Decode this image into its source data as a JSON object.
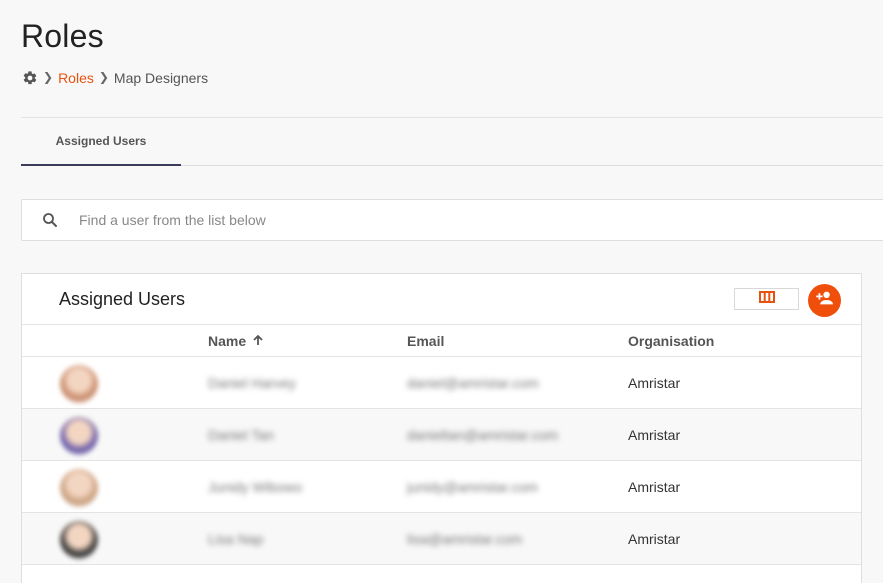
{
  "page": {
    "title": "Roles"
  },
  "breadcrumb": {
    "home_icon": "gear-icon",
    "items": [
      "Roles",
      "Map Designers"
    ]
  },
  "tabs": [
    {
      "label": "Assigned Users",
      "active": true
    }
  ],
  "search": {
    "placeholder": "Find a user from the list below",
    "value": ""
  },
  "card": {
    "title": "Assigned Users",
    "columns_icon": "columns-icon",
    "add_icon": "add-user-icon"
  },
  "table": {
    "columns": [
      "Name",
      "Email",
      "Organisation"
    ],
    "sort": {
      "column": "Name",
      "direction": "ascending"
    },
    "rows": [
      {
        "name": "Daniel Harvey",
        "email": "daniel@amristar.com",
        "organisation": "Amristar",
        "avatar_color": "#c98a6a"
      },
      {
        "name": "Daniel Tan",
        "email": "danieltan@amristar.com",
        "organisation": "Amristar",
        "avatar_color": "#6a5aa8"
      },
      {
        "name": "Junidy Wibowo",
        "email": "junidy@amristar.com",
        "organisation": "Amristar",
        "avatar_color": "#caa07e"
      },
      {
        "name": "Lisa Nap",
        "email": "lisa@amristar.com",
        "organisation": "Amristar",
        "avatar_color": "#333333"
      }
    ]
  },
  "colors": {
    "accent": "#f04e0b",
    "link": "#e8520f",
    "tab_indicator": "#3b3b5a"
  }
}
